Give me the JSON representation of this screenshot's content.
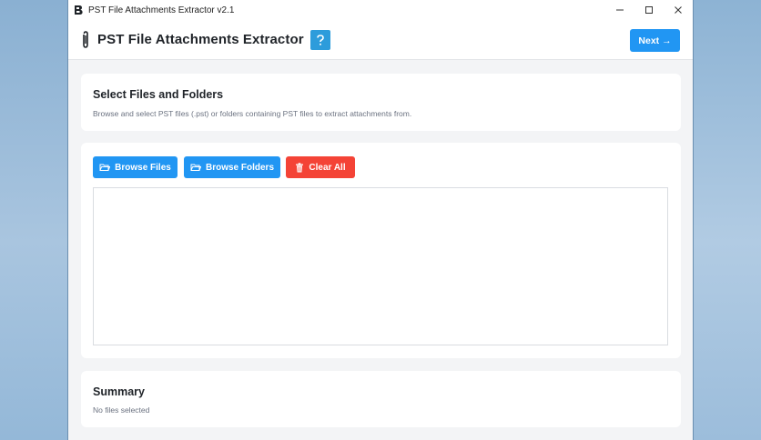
{
  "window": {
    "title": "PST File Attachments Extractor v2.1",
    "controls": [
      "minimize-icon",
      "maximize-icon",
      "close-icon"
    ]
  },
  "header": {
    "app_title": "PST File Attachments Extractor",
    "help_icon": "question-icon",
    "next_label": "Next →"
  },
  "select_section": {
    "title": "Select Files and Folders",
    "description": "Browse and select PST files (.pst) or folders containing PST files to extract attachments from."
  },
  "toolbar": {
    "browse_files_label": "Browse Files",
    "browse_folders_label": "Browse Folders",
    "clear_all_label": "Clear All"
  },
  "file_list": {
    "items": []
  },
  "summary": {
    "title": "Summary",
    "text": "No files selected"
  },
  "colors": {
    "primary": "#2196f3",
    "danger": "#f44336",
    "help": "#2d9cdb"
  }
}
